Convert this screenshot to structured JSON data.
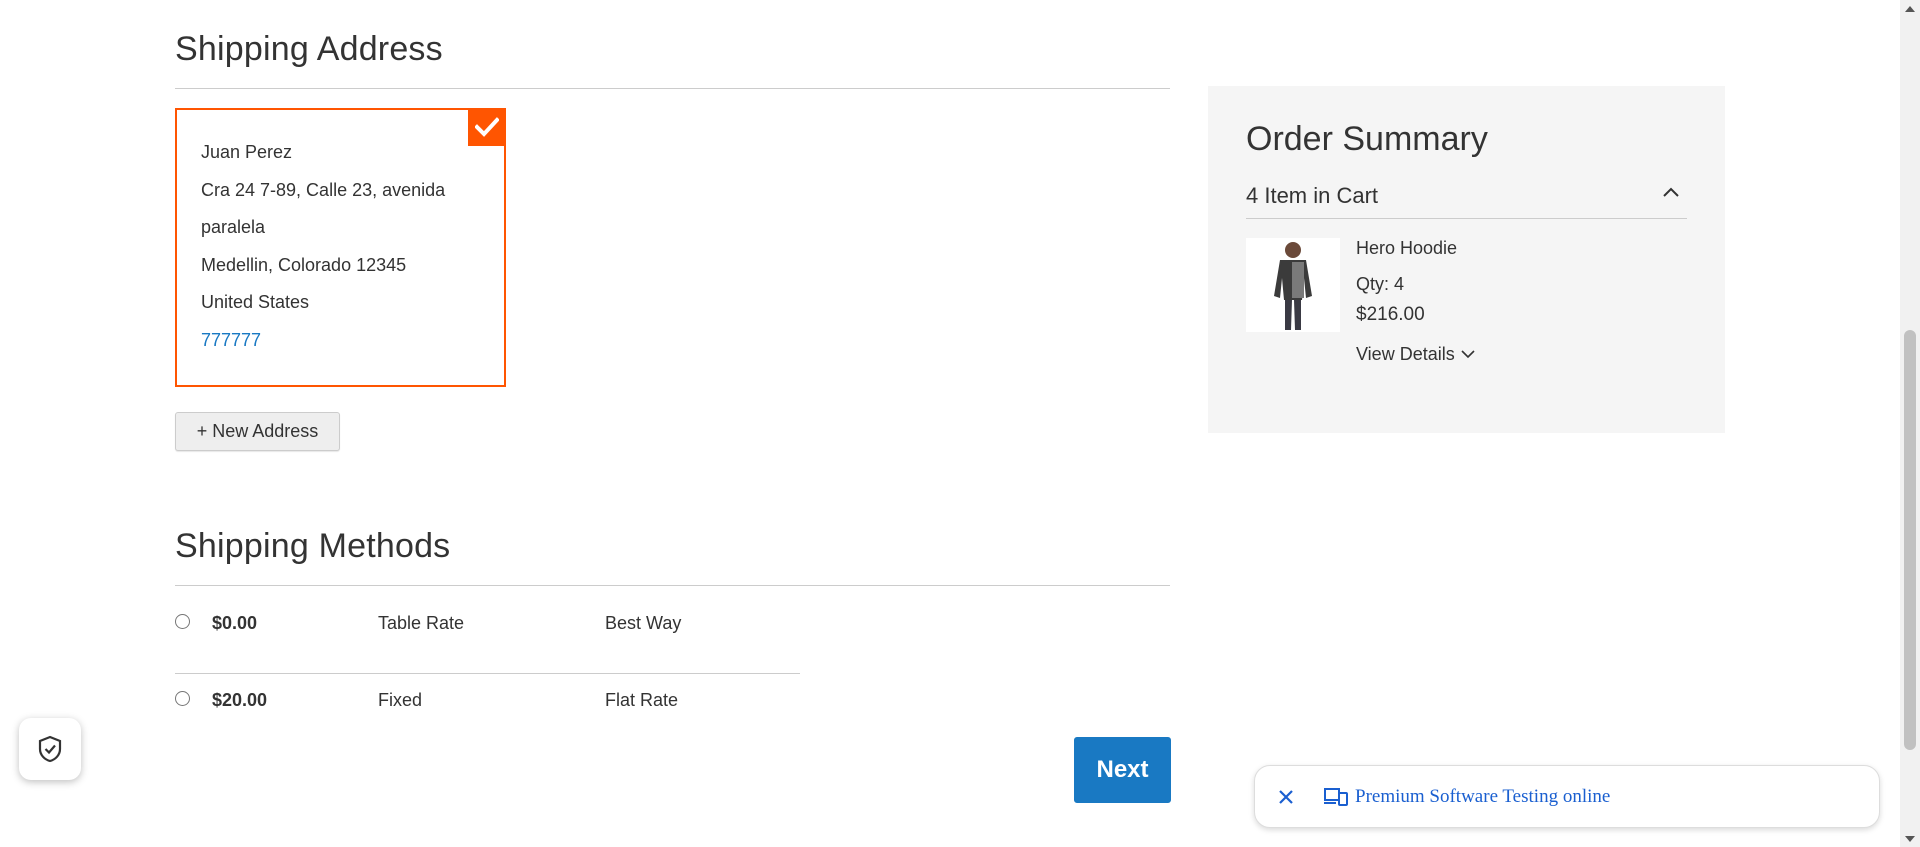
{
  "shipping_address": {
    "title": "Shipping Address",
    "address": {
      "name": "Juan Perez",
      "street_line1": "Cra 24 7-89, Calle 23, avenida",
      "street_line2": "paralela",
      "city_region_zip": "Medellin, Colorado 12345",
      "country": "United States",
      "phone": "777777"
    },
    "new_address_label": "+ New Address"
  },
  "shipping_methods": {
    "title": "Shipping Methods",
    "rows": [
      {
        "price": "$0.00",
        "carrier": "Table Rate",
        "method": "Best Way"
      },
      {
        "price": "$20.00",
        "carrier": "Fixed",
        "method": "Flat Rate"
      }
    ],
    "next_label": "Next"
  },
  "order_summary": {
    "title": "Order Summary",
    "items_count": "4 Item in Cart",
    "product": {
      "name": "Hero Hoodie",
      "qty": "Qty: 4",
      "price": "$216.00",
      "view_details": "View Details"
    }
  },
  "promo": {
    "text": "Premium Software Testing online"
  },
  "colors": {
    "accent_orange": "#ff5501",
    "primary_blue": "#1979c3",
    "link_blue": "#1a5fd0",
    "summary_bg": "#f5f5f5"
  },
  "icons": {
    "selected": "checkmark-icon",
    "chevron": "chevron-up-icon",
    "view_details": "chevron-down-icon",
    "shield": "shield-check-icon",
    "close": "close-icon",
    "devices": "devices-icon"
  }
}
